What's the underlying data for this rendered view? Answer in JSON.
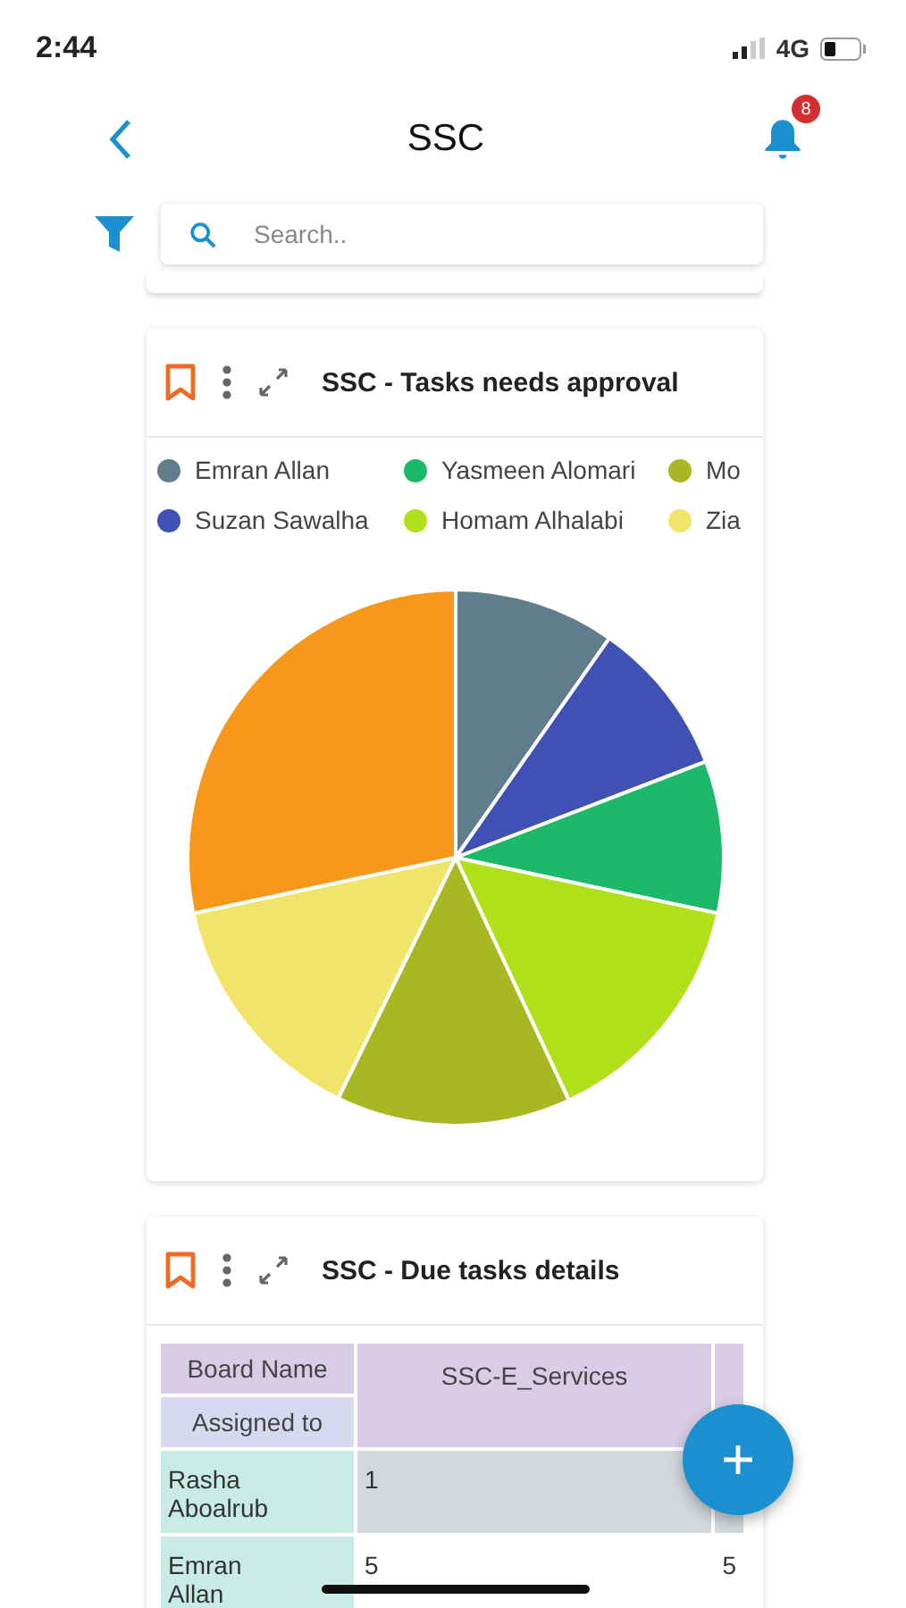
{
  "status_bar": {
    "time": "2:44",
    "network": "4G"
  },
  "header": {
    "title": "SSC",
    "notification_count": "8"
  },
  "search": {
    "placeholder": "Search.."
  },
  "widgets": [
    {
      "kind": "pie",
      "title": "SSC - Tasks needs approval",
      "legend": [
        {
          "name": "Emran Allan",
          "color": "#607d8b"
        },
        {
          "name": "Yasmeen Alomari",
          "color": "#1db96a"
        },
        {
          "name": "Mo",
          "color": "#a8b822"
        },
        {
          "name": "Suzan Sawalha",
          "color": "#3f51b5"
        },
        {
          "name": "Homam Alhalabi",
          "color": "#b0e01a"
        },
        {
          "name": "Zia",
          "color": "#f0e46a"
        }
      ]
    },
    {
      "kind": "table",
      "title": "SSC - Due tasks details",
      "row_heading": "Board Name",
      "column_heading": "Assigned to",
      "columns": [
        "SSC-E_Services"
      ],
      "rows": [
        {
          "assignee": "Rasha Aboalrub",
          "values": [
            "1"
          ]
        },
        {
          "assignee": "Emran Allan",
          "values": [
            "5",
            "5"
          ]
        }
      ]
    }
  ]
}
